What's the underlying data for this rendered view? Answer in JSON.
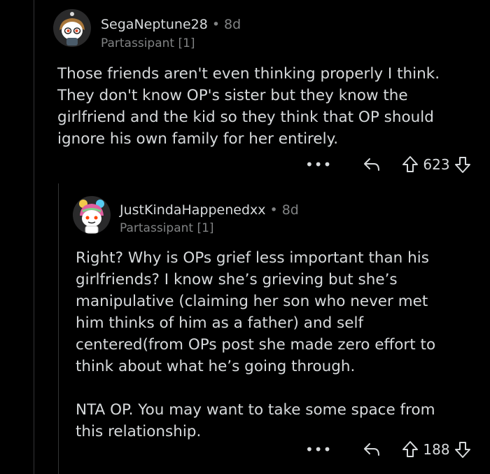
{
  "comments": [
    {
      "username": "SegaNeptune28",
      "separator": "•",
      "age": "8d",
      "flair": "Partassipant [1]",
      "body": "Those friends aren't even thinking properly I think.\nThey don't know OP's sister but they know the\ngirlfriend and the kid so they think that OP should\nignore his own family for her entirely.",
      "more_label": "•••",
      "score": "623",
      "icons": {
        "reply": "reply-arrow-icon",
        "upvote": "upvote-arrow-icon",
        "downvote": "downvote-arrow-icon"
      }
    },
    {
      "username": "JustKindaHappenedxx",
      "separator": "•",
      "age": "8d",
      "flair": "Partassipant [1]",
      "body": "Right? Why is OPs grief less important than his\ngirlfriends? I know she’s grieving but she’s\nmanipulative (claiming her son who never met\nhim thinks of him as a father) and self\ncentered(from OPs post she made zero effort to\nthink about what he’s going through.\n\nNTA OP. You may want to take some space from\nthis relationship.",
      "more_label": "•••",
      "score": "188",
      "icons": {
        "reply": "reply-arrow-icon",
        "upvote": "upvote-arrow-icon",
        "downvote": "downvote-arrow-icon"
      }
    }
  ],
  "colors": {
    "background": "#000000",
    "text": "#d7dadc",
    "muted": "#818384",
    "thread_line": "#343536"
  }
}
